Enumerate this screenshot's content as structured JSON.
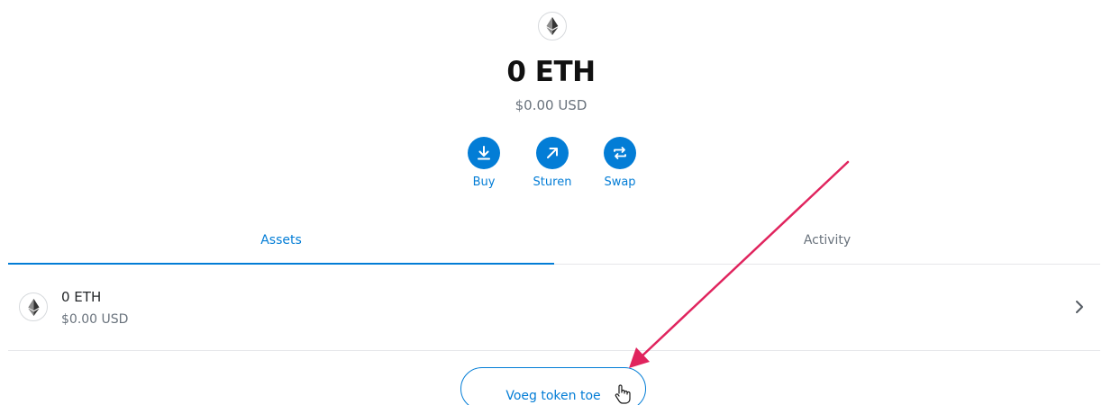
{
  "balance": {
    "amount": "0 ETH",
    "fiat": "$0.00 USD"
  },
  "actions": {
    "buy_label": "Buy",
    "send_label": "Sturen",
    "swap_label": "Swap"
  },
  "tabs": {
    "assets_label": "Assets",
    "activity_label": "Activity",
    "active": "Assets"
  },
  "assets": [
    {
      "amount": "0 ETH",
      "fiat": "$0.00 USD",
      "icon": "ethereum-icon"
    }
  ],
  "add_token": {
    "label": "Voeg token toe"
  },
  "colors": {
    "accent": "#037dd6",
    "annotation": "#e0245e",
    "muted": "#6a737d"
  }
}
